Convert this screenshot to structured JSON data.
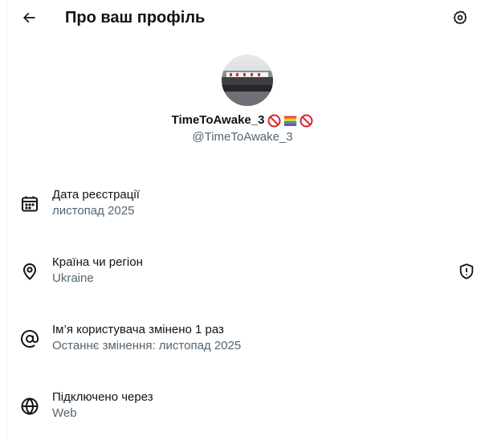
{
  "header": {
    "title": "Про ваш профіль",
    "back_icon": "arrow-left-icon",
    "settings_icon": "gear-icon"
  },
  "profile": {
    "display_name": "TimeToAwake_3",
    "name_emojis": [
      "no-entry-emoji",
      "rainbow-flag-emoji",
      "no-entry-emoji"
    ],
    "handle": "@TimeToAwake_3"
  },
  "details": [
    {
      "icon": "calendar-icon",
      "title": "Дата реєстрації",
      "value": "листопад 2025"
    },
    {
      "icon": "location-pin-icon",
      "title": "Країна чи регіон",
      "value": "Ukraine",
      "extra_icon": "shield-alert-icon"
    },
    {
      "icon": "at-sign-icon",
      "title": "Ім’я користувача змінено 1 раз",
      "value": "Останнє змінення: листопад 2025"
    },
    {
      "icon": "globe-icon",
      "title": "Підключено через",
      "value": "Web"
    }
  ],
  "colors": {
    "primary_text": "#0f1419",
    "secondary_text": "#536471",
    "border": "#eff3f4"
  }
}
